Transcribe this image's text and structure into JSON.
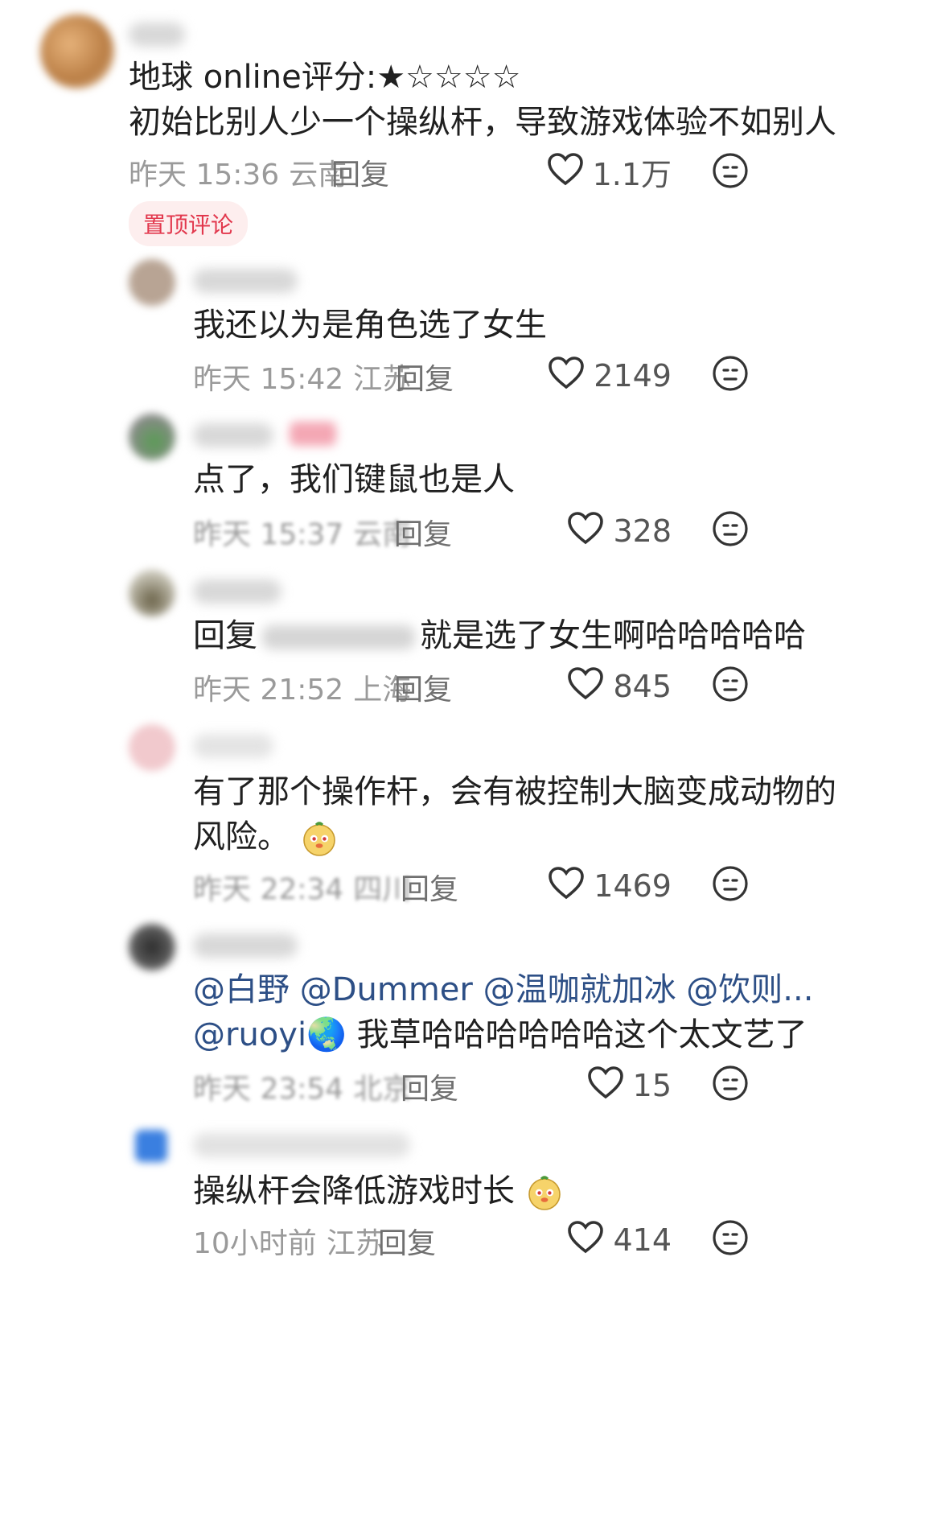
{
  "top": {
    "rating_line": "地球 online评分:★☆☆☆☆",
    "text": "初始比别人少一个操纵杆，导致游戏体验不如别人",
    "time": "昨天 15:36",
    "loc": "云南",
    "reply": "回复",
    "likes": "1.1万",
    "pin_badge": "置顶评论"
  },
  "replies": [
    {
      "text": "我还以为是角色选了女生",
      "time": "昨天 15:42",
      "loc": "江苏",
      "reply": "回复",
      "likes": "2149"
    },
    {
      "text": "点了，我们键鼠也是人",
      "time": "昨天 15:37",
      "loc": "云南",
      "reply": "回复",
      "likes": "328"
    },
    {
      "prefix": "回复",
      "text": "就是选了女生啊哈哈哈哈哈",
      "time": "昨天 21:52",
      "loc": "上海",
      "reply": "回复",
      "likes": "845"
    },
    {
      "text_line1": "有了那个操作杆，会有被控制大脑变成动物的",
      "text_line2": "风险。",
      "time": "昨天 22:34",
      "loc": "四川",
      "reply": "回复",
      "likes": "1469"
    },
    {
      "mention_line": "@白野 @Dummer @温咖就加冰 @饮则...",
      "mention_user": "@ruoyi",
      "globe": "🌏",
      "text": " 我草哈哈哈哈哈哈这个太文艺了",
      "time": "昨天 23:54",
      "loc": "北京",
      "reply": "回复",
      "likes": "15"
    },
    {
      "text": "操纵杆会降低游戏时长",
      "time": "10小时前",
      "loc": "江苏",
      "reply": "回复",
      "likes": "414"
    }
  ],
  "icons": {
    "like": "heart-outline-icon",
    "dislike": "neutral-face-icon",
    "emoji": "meerkat-emoji-icon"
  },
  "colors": {
    "pin": "#e2384d",
    "mention": "#2d4f86",
    "meta": "#9a9a9a"
  }
}
